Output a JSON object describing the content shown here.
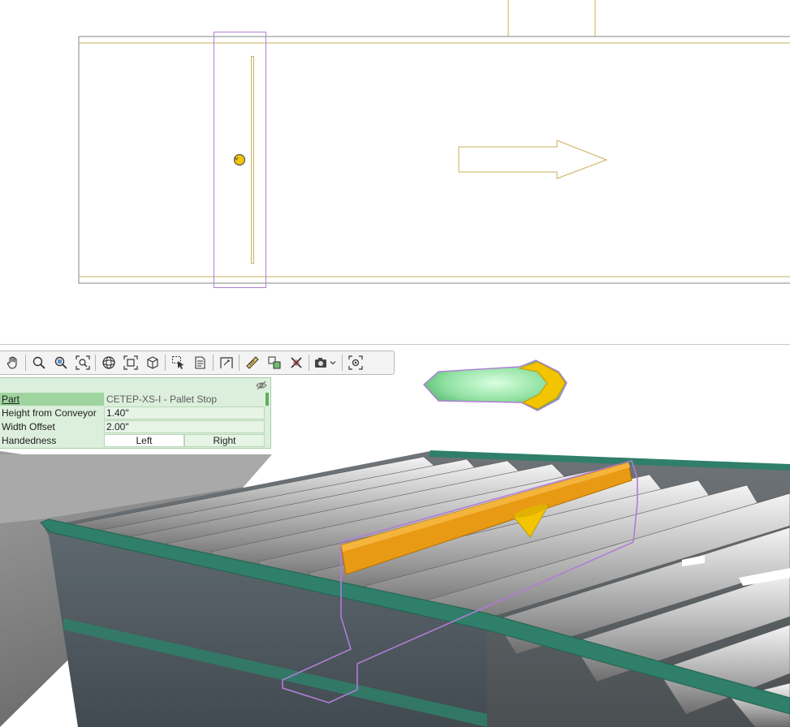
{
  "toolbar": {
    "tools": [
      {
        "name": "pan-tool",
        "icon": "hand-icon"
      },
      {
        "name": "zoom-tool",
        "icon": "magnifier-icon"
      },
      {
        "name": "zoom-window-tool",
        "icon": "zoom-window-icon"
      },
      {
        "name": "zoom-extents-tool",
        "icon": "zoom-extents-icon"
      },
      {
        "name": "orbit-tool",
        "icon": "orbit-icon"
      },
      {
        "name": "frame-tool",
        "icon": "frame-icon"
      },
      {
        "name": "iso-view-tool",
        "icon": "iso-box-icon"
      },
      {
        "name": "select-tool",
        "icon": "select-arrow-icon"
      },
      {
        "name": "properties-tool",
        "icon": "properties-icon"
      },
      {
        "name": "dimension-tool",
        "icon": "dimension-icon"
      },
      {
        "name": "measure-tool",
        "icon": "ruler-icon"
      },
      {
        "name": "copy-tool",
        "icon": "copy-shapes-icon"
      },
      {
        "name": "delete-tool",
        "icon": "delete-x-icon"
      },
      {
        "name": "camera-tool",
        "icon": "camera-icon"
      },
      {
        "name": "focus-tool",
        "icon": "focus-target-icon"
      }
    ]
  },
  "properties": {
    "part_label": "Part",
    "part_value": "CETEP-XS-I - Pallet Stop",
    "height_label": "Height from Conveyor",
    "height_value": "1.40\"",
    "width_label": "Width Offset",
    "width_value": "2.00\"",
    "handedness_label": "Handedness",
    "handedness_left": "Left",
    "handedness_right": "Right",
    "handedness_selected": "Left",
    "panel_toggle_icon": "eye-slash-icon"
  },
  "colors": {
    "plan_line": "#c9b15a",
    "plan_frame": "#7f8a7f",
    "selection": "#b07dd6",
    "conveyor_frame": "#2f7f6a",
    "pallet_stop": "#e89a14",
    "gizmo_green": "#8ee0a0",
    "gizmo_yellow": "#f3c400",
    "panel_bg": "#dcefdc"
  }
}
